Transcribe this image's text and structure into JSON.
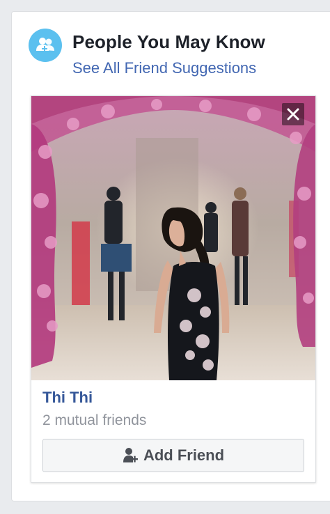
{
  "header": {
    "title": "People You May Know",
    "see_all_link": "See All Friend Suggestions"
  },
  "suggestion": {
    "name": "Thi Thi",
    "mutual_friends": "2 mutual friends",
    "add_button_label": "Add Friend",
    "photo_alt": "photo"
  },
  "colors": {
    "accent": "#4267b2",
    "name_link": "#365899",
    "icon_bg": "#5bc0ef",
    "secondary_text": "#90949c"
  },
  "icons": {
    "header": "friends-icon",
    "close": "close-icon",
    "add_friend": "add-friend-icon"
  }
}
